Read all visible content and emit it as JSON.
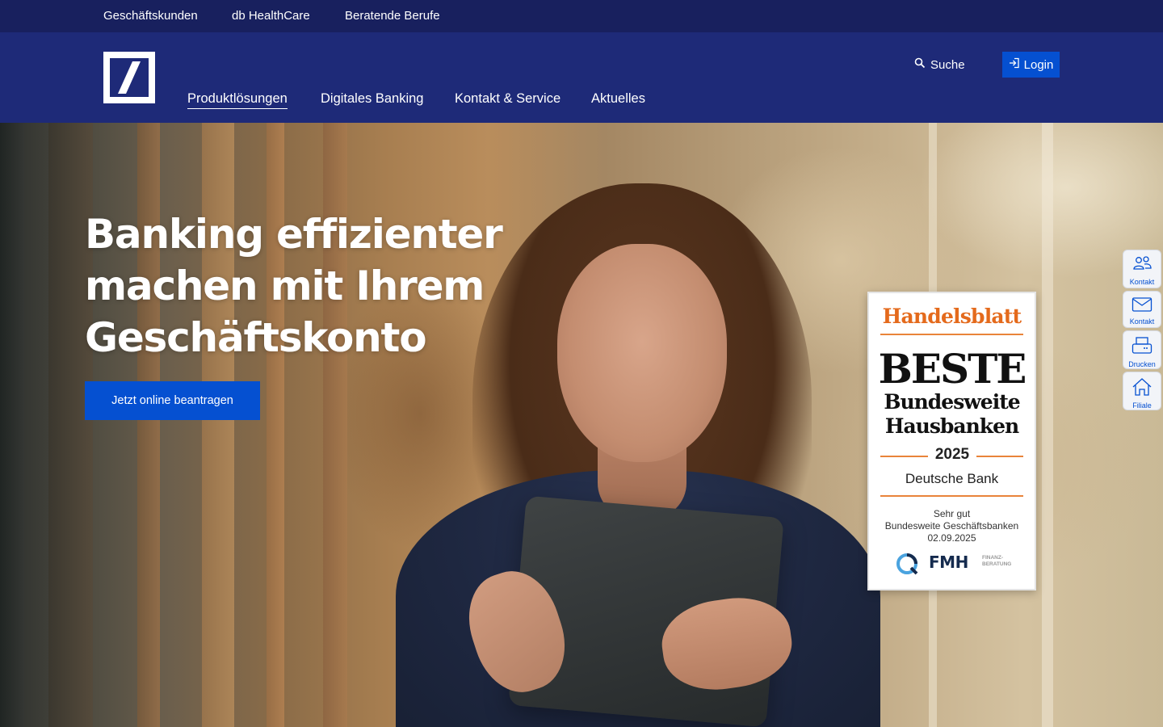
{
  "topbar": {
    "links": [
      "Geschäftskunden",
      "db HealthCare",
      "Beratende Berufe"
    ]
  },
  "header": {
    "nav": [
      "Produktlösungen",
      "Digitales Banking",
      "Kontakt & Service",
      "Aktuelles"
    ],
    "active_nav": "Produktlösungen",
    "search_label": "Suche",
    "login_label": "Login"
  },
  "hero": {
    "title_lines": [
      "Banking effizienter",
      "machen mit Ihrem",
      "Geschäftskonto"
    ],
    "cta_label": "Jetzt online beantragen"
  },
  "award": {
    "publisher": "Handelsblatt",
    "headline": "BESTE",
    "line1": "Bundesweite",
    "line2": "Hausbanken",
    "year": "2025",
    "bank": "Deutsche Bank",
    "rating": "Sehr gut",
    "category": "Bundesweite Geschäftsbanken",
    "date": "02.09.2025",
    "partner": "FMH",
    "partner_sub1": "FINANZ-",
    "partner_sub2": "BERATUNG"
  },
  "side_tools": [
    {
      "label": "Kontakt",
      "icon": "people-icon"
    },
    {
      "label": "Kontakt",
      "icon": "mail-icon"
    },
    {
      "label": "Drucken",
      "icon": "printer-icon"
    },
    {
      "label": "Filiale",
      "icon": "home-icon"
    }
  ],
  "colors": {
    "topbar_bg": "#18205e",
    "header_bg": "#1e2a78",
    "primary_button": "#0550d1",
    "award_accent": "#e46a1c"
  }
}
